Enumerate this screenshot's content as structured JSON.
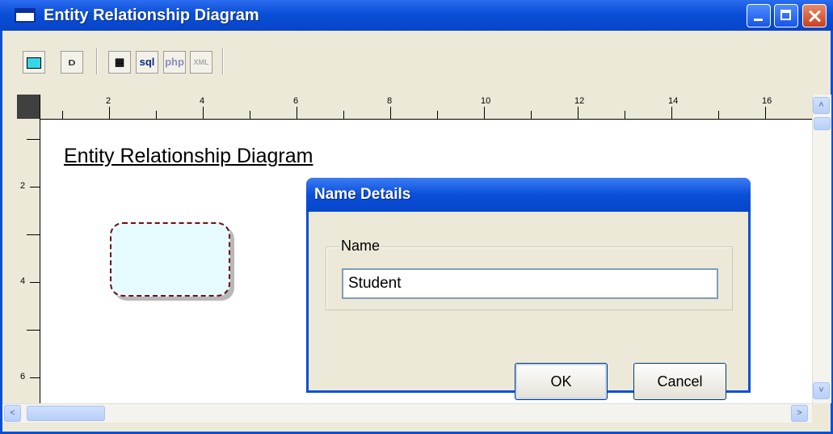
{
  "window": {
    "title": "Entity Relationship Diagram"
  },
  "toolbar": {
    "tools": [
      {
        "name": "entity-tool",
        "label": ""
      },
      {
        "name": "relationship-tool",
        "label": "⫐"
      },
      {
        "name": "grid-tool",
        "label": "▦"
      },
      {
        "name": "sql-button",
        "label": "sql"
      },
      {
        "name": "php-button",
        "label": "php"
      },
      {
        "name": "xml-button",
        "label": "XML"
      }
    ]
  },
  "ruler": {
    "horizontal_labels": [
      "2",
      "4",
      "6",
      "8",
      "10",
      "12",
      "14",
      "16"
    ],
    "vertical_labels": [
      "2",
      "4",
      "6"
    ]
  },
  "canvas": {
    "diagram_title": "Entity Relationship Diagram"
  },
  "dialog": {
    "title": "Name Details",
    "group_label": "Name",
    "name_value": "Student",
    "ok_label": "OK",
    "cancel_label": "Cancel"
  },
  "scrollbar": {
    "up": "˄",
    "down": "˅",
    "left": "˂",
    "right": "˃"
  },
  "colors": {
    "titlebar": "#0a4fd8",
    "entity_fill": "#e6fbff",
    "entity_border": "#6b1010"
  }
}
